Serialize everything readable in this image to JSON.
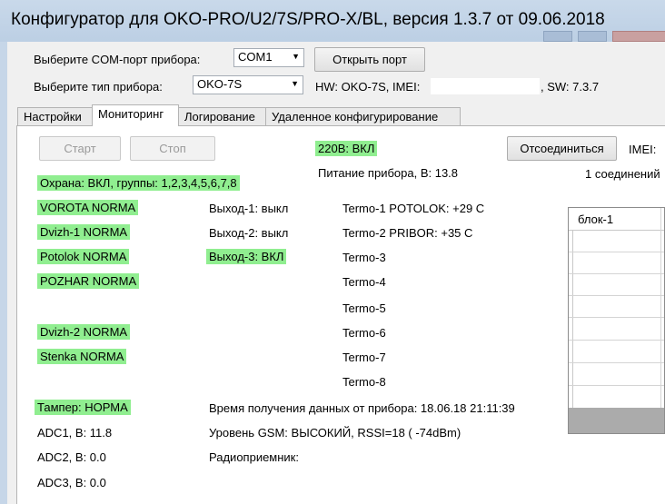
{
  "window": {
    "title": "Конфигуратор для OKO-PRO/U2/7S/PRO-X/BL, версия 1.3.7 от 09.06.2018"
  },
  "port": {
    "label": "Выберите COM-порт прибора:",
    "value": "COM1",
    "open_button": "Открыть порт"
  },
  "device": {
    "label": "Выберите тип прибора:",
    "value": "OKO-7S",
    "hw_prefix": "HW: OKO-7S, IMEI:",
    "sw": ", SW: 7.3.7"
  },
  "tabs": [
    {
      "label": "Настройки"
    },
    {
      "label": "Мониторинг"
    },
    {
      "label": "Логирование"
    },
    {
      "label": "Удаленное конфигурирование"
    }
  ],
  "monitor": {
    "start_button": "Старт",
    "stop_button": "Стоп",
    "power_220": "220В: ВКЛ",
    "disconnect_button": "Отсоединиться",
    "imei_label": "IMEI:",
    "supply": "Питание прибора, В: 13.8",
    "connections": "1 соединений",
    "guard": "Охрана: ВКЛ, группы: 1,2,3,4,5,6,7,8",
    "zones": [
      "VOROTA NORMA",
      "Dvizh-1 NORMA",
      "Potolok NORMA",
      "POZHAR NORMA",
      "Dvizh-2 NORMA",
      "Stenka NORMA"
    ],
    "outputs": [
      "Выход-1: выкл",
      "Выход-2: выкл",
      "Выход-3: ВКЛ"
    ],
    "termo": [
      "Termo-1 POTOLOK: +29 C",
      "Termo-2  PRIBOR: +35 C",
      "Termo-3",
      "Termo-4",
      "Termo-5",
      "Termo-6",
      "Termo-7",
      "Termo-8"
    ],
    "tamper": "Тампер: НОРМА",
    "data_time": "Время получения данных от прибора: 18.06.18 21:11:39",
    "adc": [
      "ADC1, В: 11.8",
      "ADC2, В: 0.0",
      "ADC3, В: 0.0"
    ],
    "gsm": "Уровень GSM: ВЫСОКИЙ, RSSI=18 ( -74dBm)",
    "radio": "Радиоприемник:",
    "grid_header": "блок-1"
  },
  "colors": {
    "highlight": "#90ee90",
    "titlebar": "#c6d6e8",
    "grid_footer": "#ababab"
  }
}
